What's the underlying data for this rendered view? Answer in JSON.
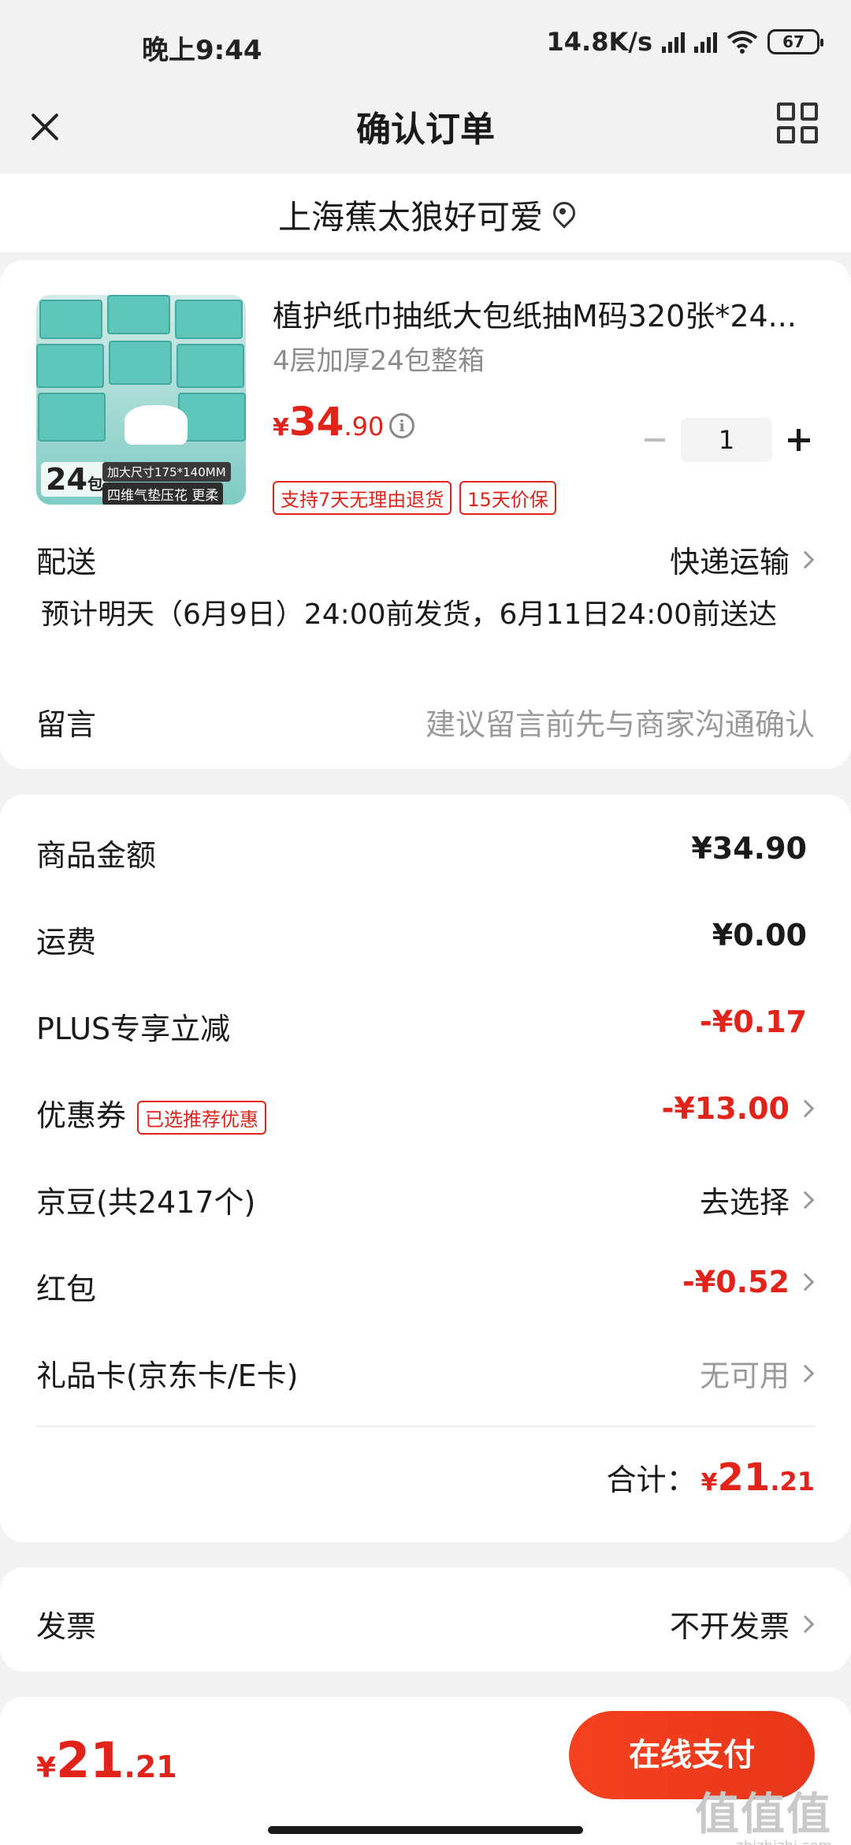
{
  "status_bar": {
    "time": "晚上9:44",
    "network_speed": "14.8K/s",
    "battery": "67"
  },
  "header": {
    "title": "确认订单",
    "close_icon": "close-icon",
    "menu_icon": "grid-icon"
  },
  "address": {
    "text": "上海蕉太狼好可爱"
  },
  "product": {
    "name": "植护纸巾抽纸大包纸抽M码320张*24...",
    "spec": "4层加厚24包整箱",
    "price_currency": "¥",
    "price_int": "34",
    "price_dec": ".90",
    "quantity": "1",
    "thumb_count": "24",
    "thumb_count_unit": "包",
    "thumb_dims": "加大尺寸175*140MM",
    "thumb_feature": "四维气垫压花 更柔",
    "tags": [
      "支持7天无理由退货",
      "15天价保"
    ]
  },
  "delivery": {
    "label": "配送",
    "method": "快递运输",
    "estimate": "预计明天（6月9日）24:00前发货，6月11日24:00前送达"
  },
  "message": {
    "label": "留言",
    "placeholder": "建议留言前先与商家沟通确认"
  },
  "amounts": {
    "goods_label": "商品金额",
    "goods_value": "¥34.90",
    "shipping_label": "运费",
    "shipping_value": "¥0.00",
    "plus_label": "PLUS专享立减",
    "plus_value": "-¥0.17",
    "coupon_label": "优惠券",
    "coupon_tag": "已选推荐优惠",
    "coupon_value": "-¥13.00",
    "jingdou_label": "京豆(共2417个)",
    "jingdou_value": "去选择",
    "redpacket_label": "红包",
    "redpacket_value": "-¥0.52",
    "giftcard_label": "礼品卡(京东卡/E卡)",
    "giftcard_value": "无可用",
    "total_label": "合计：",
    "total_currency": "¥",
    "total_int": "21",
    "total_dec": ".21"
  },
  "invoice": {
    "label": "发票",
    "value": "不开发票"
  },
  "bottom": {
    "currency": "¥",
    "price_int": "21",
    "price_dec": ".21",
    "pay_label": "在线支付",
    "watermark_big": "值值值",
    "watermark_small": "zhizhizhi.com"
  },
  "colors": {
    "accent_red": "#e2231a",
    "pay_button": "#f4411f",
    "background": "#f2f2f2"
  }
}
